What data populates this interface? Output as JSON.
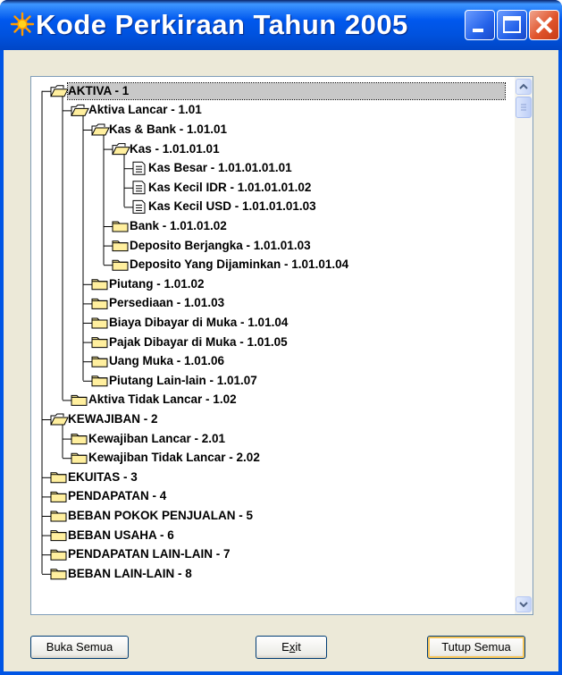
{
  "window": {
    "title": "Kode Perkiraan Tahun 2005",
    "title_icon": "star-icon",
    "controls": [
      "minimize-icon",
      "maximize-icon",
      "close-icon"
    ]
  },
  "tree": {
    "nodes": [
      {
        "label": "AKTIVA - 1",
        "depth": 0,
        "type": "open-folder",
        "selected": true
      },
      {
        "label": "Aktiva Lancar - 1.01",
        "depth": 1,
        "type": "open-folder"
      },
      {
        "label": "Kas & Bank - 1.01.01",
        "depth": 2,
        "type": "open-folder"
      },
      {
        "label": "Kas - 1.01.01.01",
        "depth": 3,
        "type": "open-folder"
      },
      {
        "label": "Kas Besar - 1.01.01.01.01",
        "depth": 4,
        "type": "document"
      },
      {
        "label": "Kas Kecil  IDR - 1.01.01.01.02",
        "depth": 4,
        "type": "document"
      },
      {
        "label": "Kas Kecil  USD - 1.01.01.01.03",
        "depth": 4,
        "type": "document"
      },
      {
        "label": "Bank - 1.01.01.02",
        "depth": 3,
        "type": "folder"
      },
      {
        "label": "Deposito Berjangka - 1.01.01.03",
        "depth": 3,
        "type": "folder"
      },
      {
        "label": "Deposito Yang Dijaminkan - 1.01.01.04",
        "depth": 3,
        "type": "folder"
      },
      {
        "label": "Piutang - 1.01.02",
        "depth": 2,
        "type": "folder"
      },
      {
        "label": "Persediaan - 1.01.03",
        "depth": 2,
        "type": "folder"
      },
      {
        "label": "Biaya Dibayar di Muka - 1.01.04",
        "depth": 2,
        "type": "folder"
      },
      {
        "label": "Pajak Dibayar di Muka - 1.01.05",
        "depth": 2,
        "type": "folder"
      },
      {
        "label": "Uang Muka - 1.01.06",
        "depth": 2,
        "type": "folder"
      },
      {
        "label": "Piutang Lain-lain - 1.01.07",
        "depth": 2,
        "type": "folder"
      },
      {
        "label": "Aktiva Tidak Lancar - 1.02",
        "depth": 1,
        "type": "folder"
      },
      {
        "label": "KEWAJIBAN - 2",
        "depth": 0,
        "type": "open-folder"
      },
      {
        "label": "Kewajiban Lancar - 2.01",
        "depth": 1,
        "type": "folder"
      },
      {
        "label": "Kewajiban Tidak Lancar - 2.02",
        "depth": 1,
        "type": "folder"
      },
      {
        "label": "EKUITAS - 3",
        "depth": 0,
        "type": "folder"
      },
      {
        "label": "PENDAPATAN - 4",
        "depth": 0,
        "type": "folder"
      },
      {
        "label": "BEBAN POKOK PENJUALAN - 5",
        "depth": 0,
        "type": "folder"
      },
      {
        "label": "BEBAN USAHA - 6",
        "depth": 0,
        "type": "folder"
      },
      {
        "label": "PENDAPATAN LAIN-LAIN - 7",
        "depth": 0,
        "type": "folder"
      },
      {
        "label": "BEBAN LAIN-LAIN - 8",
        "depth": 0,
        "type": "folder"
      }
    ]
  },
  "buttons": {
    "open_all": "Buka Semua",
    "exit_pre": "E",
    "exit_u": "x",
    "exit_post": "it",
    "close_all": "Tutup Semua"
  },
  "colors": {
    "titlebar": "#0054e3",
    "dialog_bg": "#ece9d8",
    "folder_fill": "#ffef9e",
    "close_button": "#e0542b"
  }
}
